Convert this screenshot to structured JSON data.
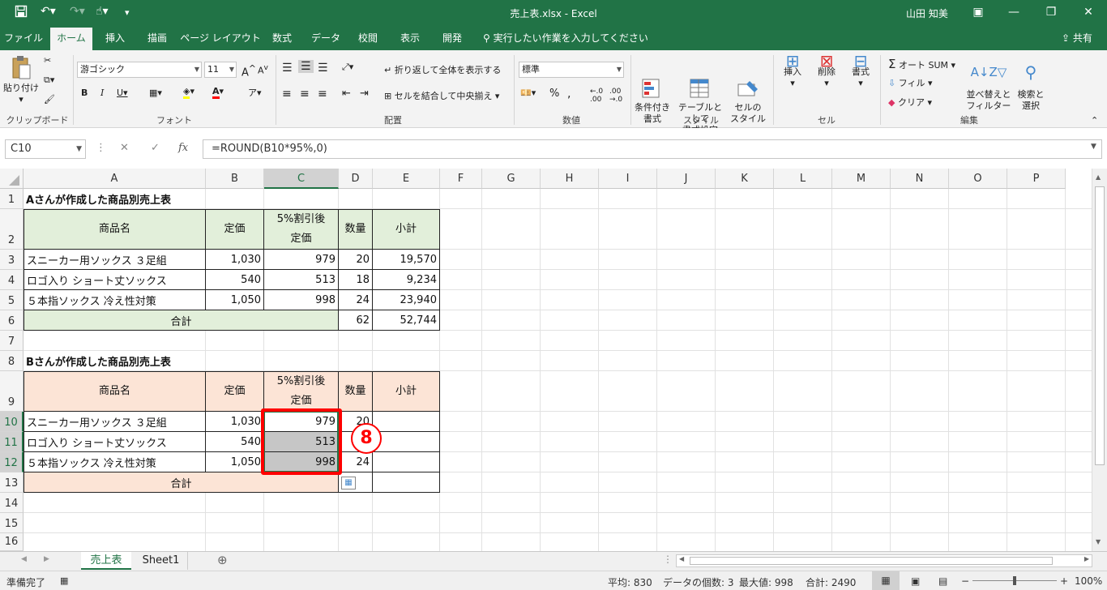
{
  "window": {
    "title": "売上表.xlsx  -  Excel",
    "user": "山田 知美"
  },
  "ribbon_tabs": [
    "ファイル",
    "ホーム",
    "挿入",
    "描画",
    "ページ レイアウト",
    "数式",
    "データ",
    "校閲",
    "表示",
    "開発"
  ],
  "tellme": "実行したい作業を入力してください",
  "share": "共有",
  "ribbon": {
    "clipboard": {
      "paste": "貼り付け",
      "label": "クリップボード"
    },
    "font": {
      "name": "游ゴシック",
      "size": "11",
      "label": "フォント"
    },
    "alignment": {
      "wrap": "折り返して全体を表示する",
      "merge": "セルを結合して中央揃え",
      "label": "配置"
    },
    "number": {
      "format": "標準",
      "label": "数値"
    },
    "styles": {
      "conditional": "条件付き\n書式",
      "table": "テーブルとして\n書式設定",
      "cellstyle": "セルの\nスタイル",
      "label": "スタイル"
    },
    "cells": {
      "insert": "挿入",
      "delete": "削除",
      "format": "書式",
      "label": "セル"
    },
    "editing": {
      "autosum": "オート SUM",
      "fill": "フィル",
      "clear": "クリア",
      "sort": "並べ替えと\nフィルター",
      "find": "検索と\n選択",
      "label": "編集"
    }
  },
  "formula_bar": {
    "name_box": "C10",
    "formula": "=ROUND(B10*95%,0)"
  },
  "columns": [
    "A",
    "B",
    "C",
    "D",
    "E",
    "F",
    "G",
    "H",
    "I",
    "J",
    "K",
    "L",
    "M",
    "N",
    "O",
    "P"
  ],
  "rows": [
    "1",
    "2",
    "3",
    "4",
    "5",
    "6",
    "7",
    "8",
    "9",
    "10",
    "11",
    "12",
    "13",
    "14",
    "15",
    "16"
  ],
  "table_a": {
    "title": "Aさんが作成した商品別売上表",
    "headers": {
      "name": "商品名",
      "price": "定価",
      "disc1": "5%割引後",
      "disc2": "定価",
      "qty": "数量",
      "subtotal": "小計"
    },
    "rows": [
      {
        "name": "スニーカー用ソックス ３足組",
        "price": "1,030",
        "disc": "979",
        "qty": "20",
        "subtotal": "19,570"
      },
      {
        "name": "ロゴ入り ショート丈ソックス",
        "price": "540",
        "disc": "513",
        "qty": "18",
        "subtotal": "9,234"
      },
      {
        "name": "５本指ソックス 冷え性対策",
        "price": "1,050",
        "disc": "998",
        "qty": "24",
        "subtotal": "23,940"
      }
    ],
    "total_label": "合計",
    "total_qty": "62",
    "total_subtotal": "52,744"
  },
  "table_b": {
    "title": "Bさんが作成した商品別売上表",
    "headers": {
      "name": "商品名",
      "price": "定価",
      "disc1": "5%割引後",
      "disc2": "定価",
      "qty": "数量",
      "subtotal": "小計"
    },
    "rows": [
      {
        "name": "スニーカー用ソックス ３足組",
        "price": "1,030",
        "disc": "979",
        "qty": "20",
        "subtotal": ""
      },
      {
        "name": "ロゴ入り ショート丈ソックス",
        "price": "540",
        "disc": "513",
        "qty": "",
        "subtotal": ""
      },
      {
        "name": "５本指ソックス 冷え性対策",
        "price": "1,050",
        "disc": "998",
        "qty": "24",
        "subtotal": ""
      }
    ],
    "total_label": "合計"
  },
  "annotation": {
    "step": "8"
  },
  "sheets": [
    "売上表",
    "Sheet1"
  ],
  "status": {
    "ready": "準備完了",
    "average": "平均: 830",
    "count": "データの個数: 3",
    "max": "最大値: 998",
    "sum": "合計: 2490",
    "zoom": "100%"
  },
  "colors": {
    "excel_green": "#217346",
    "table_a_fill": "#e2efda",
    "table_b_fill": "#fce4d6",
    "highlight": "#ff0000"
  }
}
